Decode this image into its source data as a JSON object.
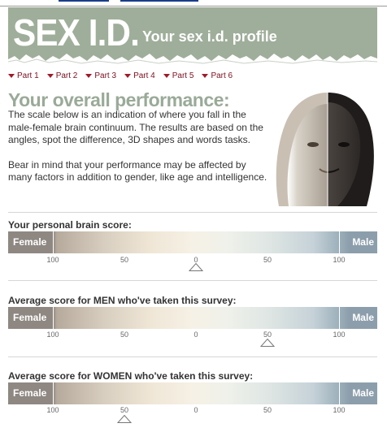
{
  "header": {
    "logo_text": "SEX I.D.",
    "subtitle": "Your sex i.d. profile"
  },
  "nav": {
    "items": [
      "Part 1",
      "Part 2",
      "Part 3",
      "Part 4",
      "Part 5",
      "Part 6"
    ]
  },
  "performance": {
    "title": "Your overall performance:",
    "paragraph1": "The scale below is an indication of where you fall in the male-female brain continuum. The results are based on the angles, spot the difference, 3D shapes and words tasks.",
    "paragraph2": "Bear in mind that your performance may be affected by many factors in addition to gender, like age and intelligence."
  },
  "scale_labels": {
    "female": "Female",
    "male": "Male",
    "ticks": [
      "100",
      "50",
      "0",
      "50",
      "100"
    ]
  },
  "scores": [
    {
      "label": "Your personal brain score:",
      "marker_value": 0
    },
    {
      "label": "Average score for MEN who've taken this survey:",
      "marker_value": 50
    },
    {
      "label": "Average score for WOMEN who've taken this survey:",
      "marker_value": -50
    }
  ],
  "colors": {
    "banner": "#9fae9a",
    "nav_text": "#7a1020",
    "title": "#9aaa98",
    "female_end": "#8f8882",
    "male_end": "#8c9eab"
  }
}
